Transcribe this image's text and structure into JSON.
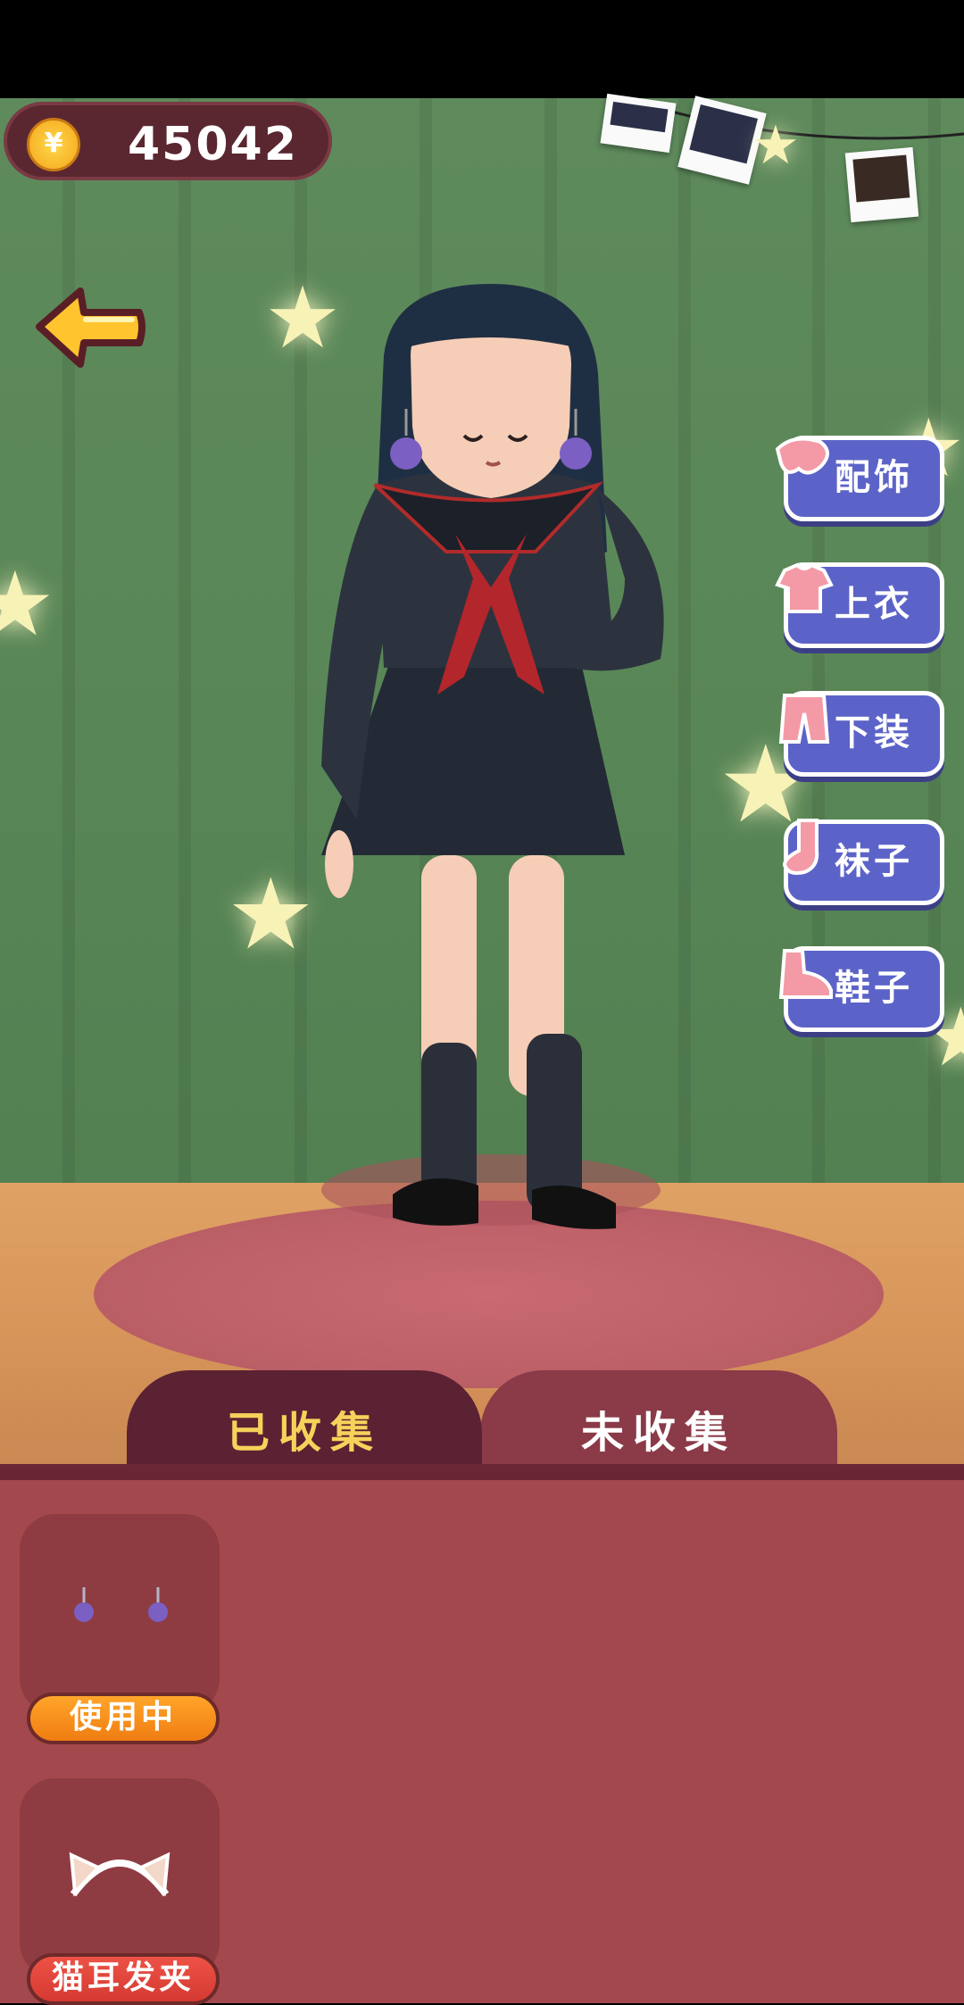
{
  "hud": {
    "coins": "45042"
  },
  "categories": [
    {
      "label": "配饰",
      "icon": "hair-accessory-icon"
    },
    {
      "label": "上衣",
      "icon": "shirt-icon"
    },
    {
      "label": "下装",
      "icon": "pants-icon"
    },
    {
      "label": "袜子",
      "icon": "sock-icon"
    },
    {
      "label": "鞋子",
      "icon": "shoe-icon"
    }
  ],
  "tabs": {
    "collected": "已收集",
    "uncollected": "未收集"
  },
  "items": [
    {
      "name": "earrings",
      "button": "使用中",
      "state": "in-use"
    },
    {
      "name": "cat-ear-headband",
      "button": "猫耳发夹",
      "state": "available"
    }
  ],
  "colors": {
    "accent": "#5c63c8",
    "coin": "#f8b52a",
    "panel": "#a3484c",
    "tab_active_text": "#f5d35b"
  }
}
